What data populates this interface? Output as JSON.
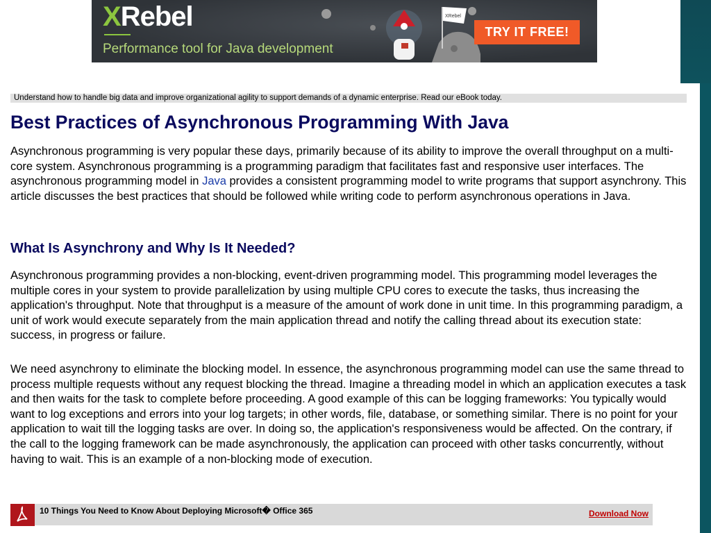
{
  "banner": {
    "logo_x": "X",
    "logo_rest": "Rebel",
    "tagline": "Performance tool for Java development",
    "cta": "TRY IT FREE!",
    "flag_text": "XRebel"
  },
  "promo": {
    "text": "Understand how to handle big data and improve organizational agility to support demands of a dynamic enterprise. Read our eBook today."
  },
  "article": {
    "title": "Best Practices of Asynchronous Programming With Java",
    "intro_before_link": "Asynchronous programming is very popular these days, primarily because of its ability to improve the overall throughput on a multi-core system. Asynchronous programming is a programming paradigm that facilitates fast and responsive user interfaces. The asynchronous programming model in ",
    "intro_link": "Java",
    "intro_after_link": " provides a consistent programming model to write programs that support asynchrony. This article discusses the best practices that should be followed while writing code to perform asynchronous operations in Java.",
    "section1_heading": "What Is Asynchrony and Why Is It Needed?",
    "section1_p1": "Asynchronous programming provides a non-blocking, event-driven programming model. This programming model leverages the multiple cores in your system to provide parallelization by using multiple CPU cores to execute the tasks, thus increasing the application's throughput. Note that throughput is a measure of the amount of work done in unit time. In this programming paradigm, a unit of work would execute separately from the main application thread and notify the calling thread about its execution state: success, in progress or failure.",
    "section1_p2": "We need asynchrony to eliminate the blocking model. In essence, the asynchronous programming model can use the same thread to process multiple requests without any request blocking the thread. Imagine a threading model in which an application executes a task and then waits for the task to complete before proceeding. A good example of this can be logging frameworks: You typically would want to log exceptions and errors into your log targets; in other words, file, database, or something similar. There is no point for your application to wait till the logging tasks are over. In doing so, the application's responsiveness would be affected. On the contrary, if the call to the logging framework can be made asynchronously, the application can proceed with other tasks concurrently, without having to wait. This is an example of a non-blocking mode of execution."
  },
  "download": {
    "title": "10 Things You Need to Know About Deploying Microsoft� Office 365",
    "link": "Download Now"
  },
  "colors": {
    "title": "#0a0a5e",
    "link": "#1a3ca8",
    "cta": "#f05a28",
    "download_link": "#c00000",
    "background_teal": "#0d5e68"
  }
}
